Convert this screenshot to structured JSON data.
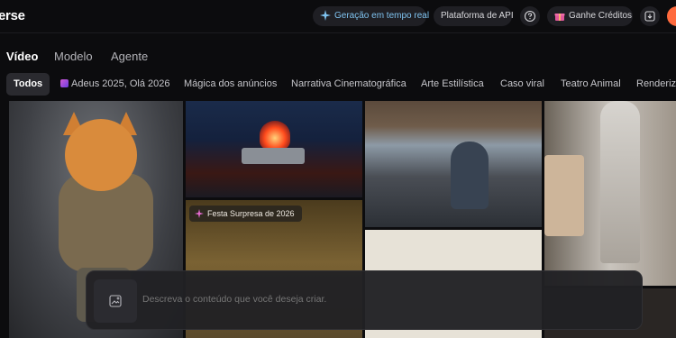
{
  "header": {
    "logo": "erse",
    "realtime_label": "Geração em tempo real",
    "api_label": "Plataforma de API",
    "help_icon": "help-circle-icon",
    "credits_label": "Ganhe Créditos",
    "download_icon": "download-icon",
    "colors": {
      "realtime_text": "#7fc3f0",
      "avatar": "#ff6a3d"
    }
  },
  "tabs": [
    {
      "label": "Vídeo",
      "active": true
    },
    {
      "label": "Modelo",
      "active": false
    },
    {
      "label": "Agente",
      "active": false
    }
  ],
  "categories": [
    {
      "label": "Todos",
      "active": true
    },
    {
      "label": "Adeus 2025, Olá 2026",
      "active": false
    },
    {
      "label": "Mágica dos anúncios",
      "active": false
    },
    {
      "label": "Narrativa Cinematográfica",
      "active": false
    },
    {
      "label": "Arte Estilística",
      "active": false
    },
    {
      "label": "Caso viral",
      "active": false
    },
    {
      "label": "Teatro Animal",
      "active": false
    },
    {
      "label": "Renderiza",
      "active": false
    }
  ],
  "gallery": {
    "badge_label": "Festa Surpresa de 2026"
  },
  "prompt": {
    "placeholder": "Descreva o conteúdo que você deseja criar."
  }
}
